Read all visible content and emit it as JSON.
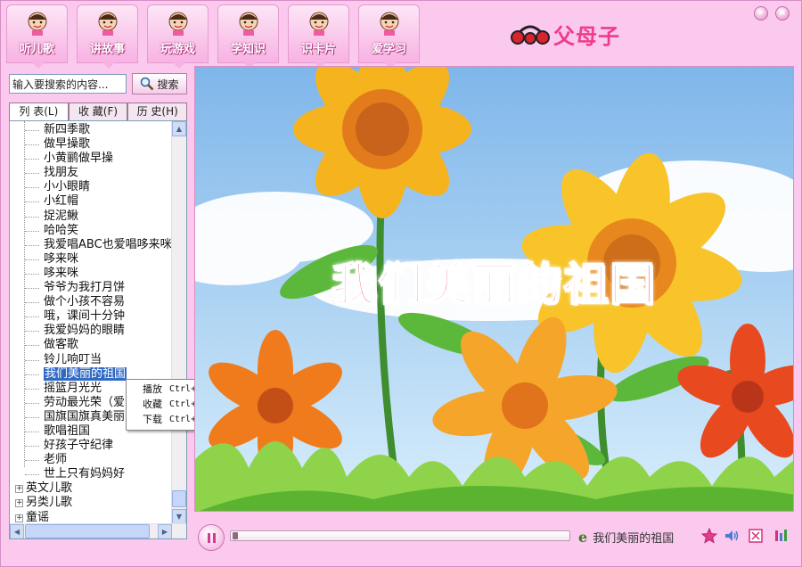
{
  "nav": {
    "tabs": [
      {
        "label": "听儿歌",
        "icon": "girl-headphones-icon"
      },
      {
        "label": "讲故事",
        "icon": "boy-storyteller-icon"
      },
      {
        "label": "玩游戏",
        "icon": "boy-ball-icon"
      },
      {
        "label": "学知识",
        "icon": "child-reading-icon"
      },
      {
        "label": "识卡片",
        "icon": "child-cards-icon"
      },
      {
        "label": "爱学习",
        "icon": "girl-studying-icon"
      }
    ]
  },
  "logo": {
    "brand": "父母子"
  },
  "search": {
    "placeholder": "输入要搜索的内容...",
    "value": "输入要搜索的内容...",
    "button_label": "搜索"
  },
  "tabs": [
    {
      "label": "列 表(L)",
      "active": true
    },
    {
      "label": "收 藏(F)",
      "active": false
    },
    {
      "label": "历 史(H)",
      "active": false
    }
  ],
  "tree": {
    "songs": [
      "新四季歌",
      "做早操歌",
      "小黄鹂做早操",
      "找朋友",
      "小小眼睛",
      "小红帽",
      "捉泥鳅",
      "哈哈笑",
      "我爱唱ABC也爱唱哆来咪",
      "哆来咪",
      "哆来咪",
      "爷爷为我打月饼",
      "做个小孩不容易",
      "哦，课间十分钟",
      "我爱妈妈的眼睛",
      "做客歌",
      "铃儿响叮当",
      "我们美丽的祖国",
      "摇篮月光光",
      "劳动最光荣（爱",
      "国旗国旗真美丽",
      "歌唱祖国",
      "好孩子守纪律",
      "老师",
      "世上只有妈妈好"
    ],
    "selected": "我们美丽的祖国",
    "categories": [
      "英文儿歌",
      "另类儿歌",
      "童谣"
    ]
  },
  "context_menu": {
    "items": [
      {
        "label": "播放",
        "shortcut": "Ctrl+P"
      },
      {
        "label": "收藏",
        "shortcut": "Ctrl+S"
      },
      {
        "label": "下载",
        "shortcut": "Ctrl+D"
      }
    ]
  },
  "video": {
    "title": "我们美丽的祖国"
  },
  "player": {
    "now_playing": "我们美丽的祖国",
    "progress": 0.0
  },
  "colors": {
    "accent": "#ef3c8a",
    "background": "#fbc8ee",
    "title_red": "#e8102a",
    "selection": "#316ac5"
  }
}
